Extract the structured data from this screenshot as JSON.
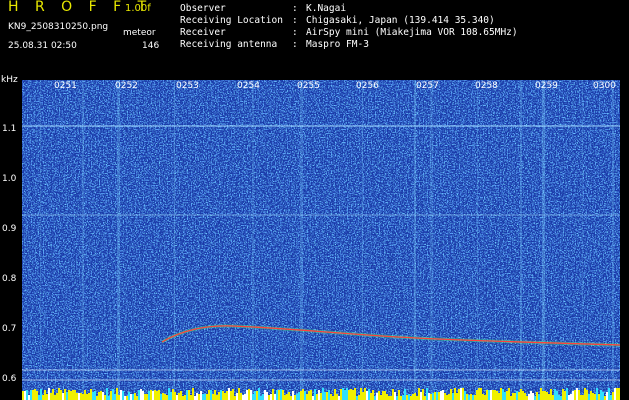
{
  "header": {
    "app_title": "H R O F F T",
    "app_version": "1.00f",
    "file_name": "KN9_2508310250.png",
    "datetime": "25.08.31 02:50",
    "meteor_label": "meteor",
    "meteor_count": "146"
  },
  "info": [
    {
      "key": "Observer",
      "sep": ":",
      "value": "K.Nagai"
    },
    {
      "key": "Receiving Location",
      "sep": ":",
      "value": "Chigasaki, Japan (139.414 35.340)"
    },
    {
      "key": "Receiver",
      "sep": ":",
      "value": "AirSpy mini (Miakejima VOR 108.65MHz)"
    },
    {
      "key": "Receiving antenna",
      "sep": ":",
      "value": "Maspro FM-3"
    }
  ],
  "axis": {
    "y_unit": "kHz",
    "y_ticks": [
      "1.1",
      "1.0",
      "0.9",
      "0.8",
      "0.7",
      "0.6"
    ],
    "time_ticks": [
      "0251",
      "0252",
      "0253",
      "0254",
      "0255",
      "0256",
      "0257",
      "0258",
      "0259",
      "0300"
    ]
  },
  "colors": {
    "background": "#000000",
    "spectrum_bg": "#1a3aa8",
    "title": "#e8e800",
    "trace": "#ff4040",
    "carrier_line": "#9fd8ff"
  }
}
